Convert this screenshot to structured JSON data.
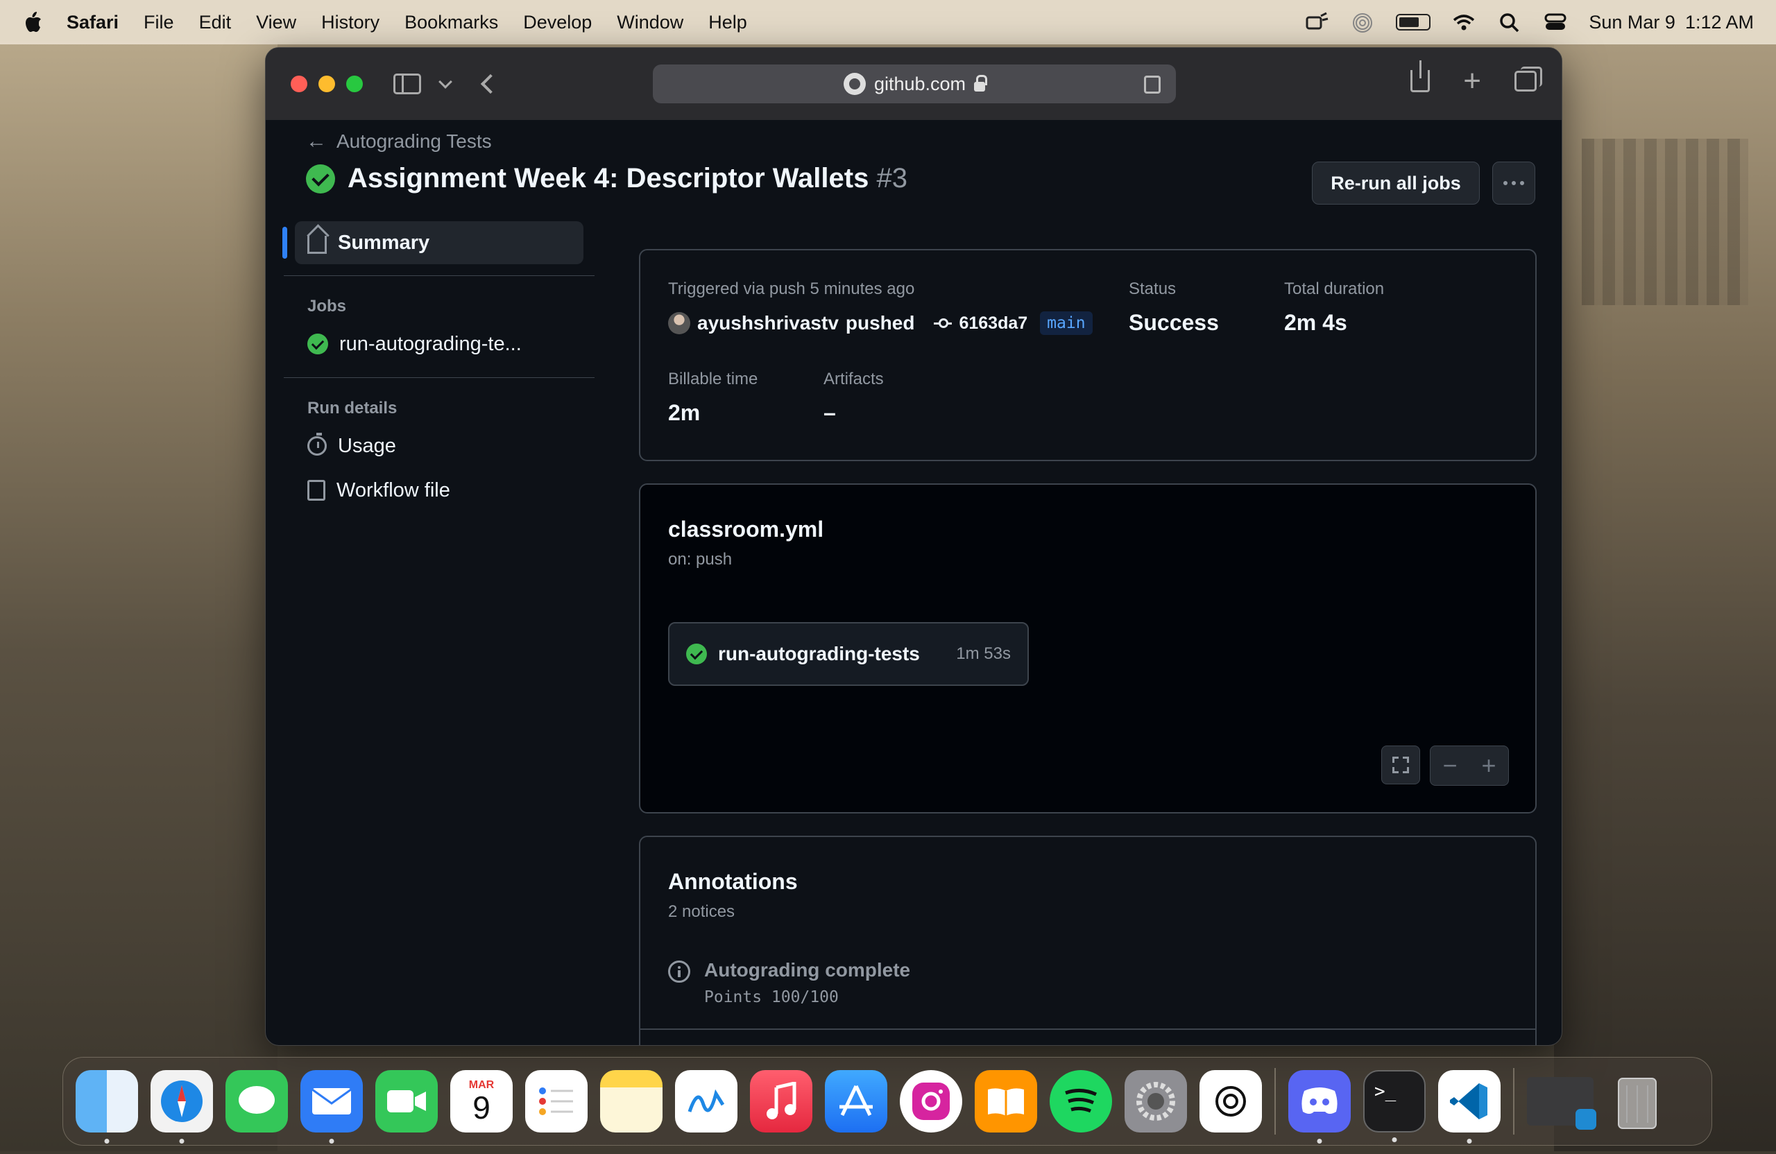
{
  "menubar": {
    "app": "Safari",
    "items": [
      "File",
      "Edit",
      "View",
      "History",
      "Bookmarks",
      "Develop",
      "Window",
      "Help"
    ],
    "date": "Sun Mar 9",
    "time": "1:12 AM"
  },
  "browser": {
    "url": "github.com"
  },
  "page": {
    "breadcrumb": "Autograding Tests",
    "title": "Assignment Week 4: Descriptor Wallets",
    "run_number": "#3",
    "rerun_label": "Re-run all jobs"
  },
  "nav": {
    "summary": "Summary",
    "jobs_heading": "Jobs",
    "job": "run-autograding-te...",
    "run_details_heading": "Run details",
    "usage": "Usage",
    "workflow_file": "Workflow file"
  },
  "summary": {
    "triggered": "Triggered via push 5 minutes ago",
    "actor": "ayushshrivastv",
    "pushed": "pushed",
    "sha": "6163da7",
    "branch": "main",
    "status_label": "Status",
    "status_value": "Success",
    "duration_label": "Total duration",
    "duration_value": "2m 4s",
    "billable_label": "Billable time",
    "billable_value": "2m",
    "artifacts_label": "Artifacts",
    "artifacts_value": "–"
  },
  "workflow": {
    "file": "classroom.yml",
    "trigger": "on: push",
    "job_name": "run-autograding-tests",
    "job_duration": "1m 53s"
  },
  "annotations": {
    "title": "Annotations",
    "count": "2 notices",
    "item_title": "Autograding complete",
    "item_body": "Points 100/100"
  },
  "dock": {
    "calendar_month": "MAR",
    "calendar_day": "9",
    "apps": [
      "finder-icon",
      "safari-icon",
      "messages-icon",
      "mail-icon",
      "facetime-icon",
      "calendar-icon",
      "reminders-icon",
      "notes-icon",
      "freeform-icon",
      "music-icon",
      "app-store-icon",
      "instagram-icon",
      "books-icon",
      "spotify-icon",
      "system-settings-icon",
      "chatgpt-icon",
      "discord-icon",
      "terminal-icon",
      "vscode-icon",
      "window-thumbnail-icon",
      "trash-icon"
    ]
  },
  "colors": {
    "success": "#3fb950",
    "accent": "#2f81f7",
    "bg": "#0d1117"
  }
}
